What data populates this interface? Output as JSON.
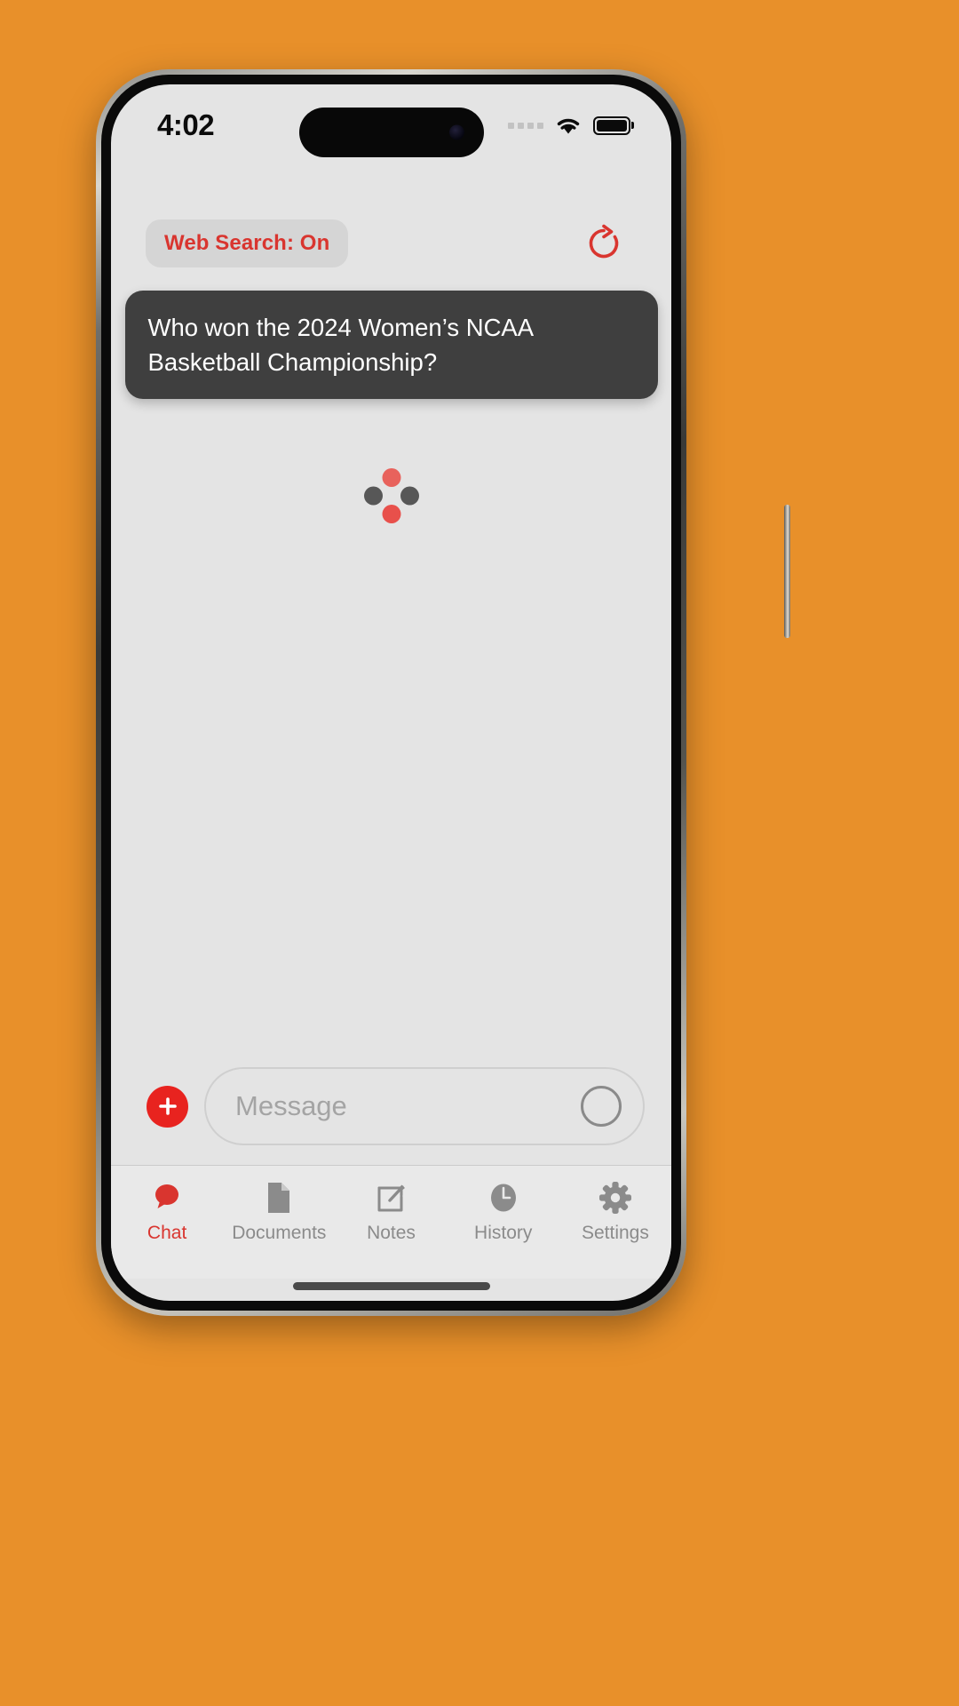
{
  "background_color": "#e8902a",
  "statusbar": {
    "time": "4:02",
    "signal_icon": "signal-dots-icon",
    "wifi_icon": "wifi-icon",
    "battery_icon": "battery-full-icon"
  },
  "toolbar": {
    "web_search_label": "Web Search: On",
    "web_search_color": "#d9352f",
    "refresh_icon": "refresh-icon"
  },
  "chat": {
    "messages": [
      {
        "role": "user",
        "text": "Who won the 2024 Women’s NCAA Basketball Championship?"
      }
    ],
    "loading_indicator": {
      "visible": true,
      "dot_colors": [
        "#e8625c",
        "#575757",
        "#e8504b",
        "#575757"
      ]
    }
  },
  "composer": {
    "add_icon": "plus-icon",
    "add_color": "#e8231f",
    "placeholder": "Message",
    "value": "",
    "mic_icon": "record-circle-icon"
  },
  "tabbar": {
    "active_index": 0,
    "active_color": "#d9352f",
    "inactive_color": "#8b8b8b",
    "items": [
      {
        "label": "Chat",
        "icon": "chat-bubble-icon"
      },
      {
        "label": "Documents",
        "icon": "document-icon"
      },
      {
        "label": "Notes",
        "icon": "note-pencil-icon"
      },
      {
        "label": "History",
        "icon": "clock-icon"
      },
      {
        "label": "Settings",
        "icon": "gear-icon"
      }
    ]
  }
}
